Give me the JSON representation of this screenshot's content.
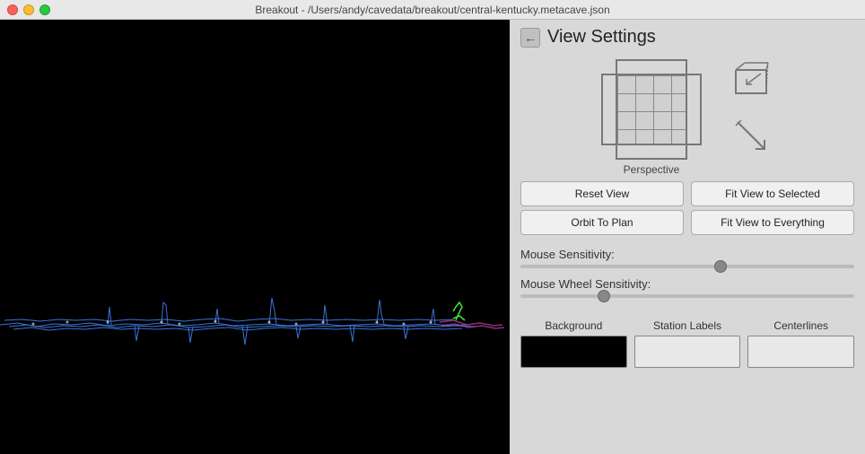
{
  "titleBar": {
    "title": "Breakout - /Users/andy/cavedata/breakout/central-kentucky.metacave.json"
  },
  "panel": {
    "title": "View Settings",
    "toggle_icon": "←",
    "perspective_label": "Perspective"
  },
  "buttons": {
    "reset_view": "Reset View",
    "fit_view_selected": "Fit View to Selected",
    "orbit_to_plan": "Orbit To Plan",
    "fit_view_everything": "Fit View to Everything"
  },
  "sliders": {
    "mouse_sensitivity_label": "Mouse Sensitivity:",
    "mouse_sensitivity_value": 60,
    "mouse_wheel_label": "Mouse Wheel Sensitivity:",
    "mouse_wheel_value": 25
  },
  "colorBoxes": {
    "background_label": "Background",
    "station_labels_label": "Station Labels",
    "centerlines_label": "Centerlines"
  }
}
